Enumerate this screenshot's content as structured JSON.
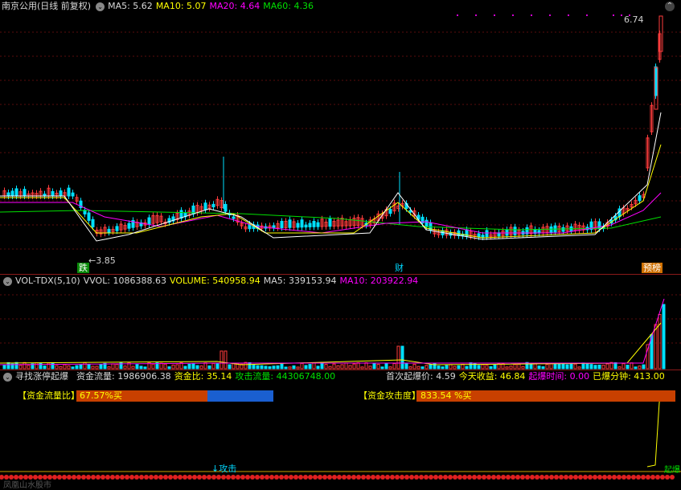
{
  "price_panel": {
    "title": "南京公用(日线 前复权)",
    "ma5": "MA5: 5.62",
    "ma10": "MA10: 5.07",
    "ma20": "MA20: 4.64",
    "ma60": "MA60: 4.36",
    "high_label": "6.74",
    "low_label": "3.85",
    "marker_die": "跌",
    "marker_cai": "财",
    "marker_yubang": "预榜"
  },
  "volume_panel": {
    "title": "VOL-TDX(5,10)",
    "vvol": "VVOL: 1086388.63",
    "volume": "VOLUME: 540958.94",
    "ma5": "MA5: 339153.94",
    "ma10": "MA10: 203922.94"
  },
  "indicator_panel": {
    "title": "寻找涨停起爆",
    "fund_flow": "资金流量: 1986906.38",
    "fund_ratio": "资金比: 35.14",
    "attack_flow": "攻击流量: 44306748.00",
    "first_price": "首次起爆价: 4.59",
    "today_gain": "今天收益: 46.84",
    "burst_time": "起爆时间: 0.00",
    "burst_minutes": "已爆分钟: 413.00",
    "ratio_bar_label": "【资金流量比】",
    "ratio_bar_value": "67.57%买",
    "attack_bar_label": "【资金攻击度】",
    "attack_bar_value": "833.54 %买",
    "attack_marker": "攻击",
    "bottom_text": "凤凰山水股市",
    "right_marker": "起爆"
  },
  "colors": {
    "up": "#ff3c3c",
    "down": "#00e0ff",
    "ma5": "#ffffff",
    "ma10": "#ffff00",
    "ma20": "#ff00ff",
    "ma60": "#00e000",
    "separator": "#8b1a1a",
    "bar_red": "#c84000",
    "bar_blue": "#1a5fd0"
  }
}
